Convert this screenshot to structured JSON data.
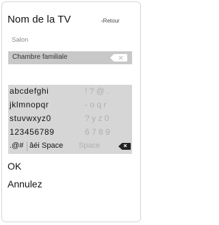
{
  "header": {
    "title": "Nom de la TV",
    "back_label": "‹Retour"
  },
  "options": {
    "salon": "Salon"
  },
  "input": {
    "value": "Chambre familiale"
  },
  "keyboard": {
    "rows": [
      {
        "active": "abcdefghi",
        "dim": "! ? @ ."
      },
      {
        "active": "jklmnopqr",
        "dim": "- o q r"
      },
      {
        "active": "stuvwxyz0",
        "dim": "? y z 0"
      },
      {
        "active": "123456789",
        "dim": "6 7 8 9"
      }
    ],
    "symbols_key": ".@#",
    "lang_key": "âéi",
    "space_key": "Space",
    "space_key_dim": "Space"
  },
  "actions": {
    "ok": "OK",
    "cancel": "Annulez"
  }
}
